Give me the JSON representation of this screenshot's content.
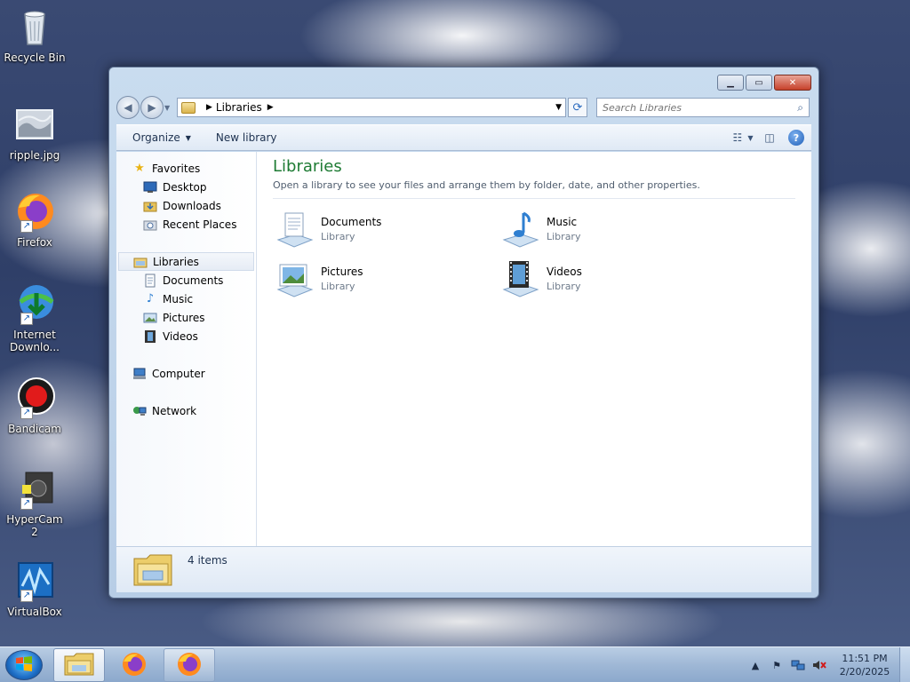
{
  "desktop": {
    "icons": [
      {
        "label": "Recycle Bin"
      },
      {
        "label": "ripple.jpg"
      },
      {
        "label": "Firefox"
      },
      {
        "label": "Internet Downlo..."
      },
      {
        "label": "Bandicam"
      },
      {
        "label": "HyperCam 2"
      },
      {
        "label": "VirtualBox"
      }
    ]
  },
  "window": {
    "address": {
      "crumb": "Libraries"
    },
    "search": {
      "placeholder": "Search Libraries"
    },
    "toolbar": {
      "organize_label": "Organize",
      "new_library_label": "New library"
    },
    "nav_pane": {
      "favorites": "Favorites",
      "favorites_items": [
        "Desktop",
        "Downloads",
        "Recent Places"
      ],
      "libraries": "Libraries",
      "libraries_items": [
        "Documents",
        "Music",
        "Pictures",
        "Videos"
      ],
      "computer": "Computer",
      "network": "Network"
    },
    "content": {
      "title": "Libraries",
      "description": "Open a library to see your files and arrange them by folder, date, and other properties.",
      "items": [
        {
          "name": "Documents",
          "type": "Library"
        },
        {
          "name": "Music",
          "type": "Library"
        },
        {
          "name": "Pictures",
          "type": "Library"
        },
        {
          "name": "Videos",
          "type": "Library"
        }
      ]
    },
    "details": {
      "count": "4 items"
    }
  },
  "taskbar": {
    "clock_time": "11:51 PM",
    "clock_date": "2/20/2025"
  },
  "colors": {
    "accent_green": "#1e7b34",
    "window_frame": "#c9dcef",
    "close_red": "#c6402a"
  },
  "icons": {
    "favorites": "star-icon",
    "desktop": "desktop-icon",
    "downloads": "downloads-folder-icon",
    "recent": "recent-places-icon",
    "libraries": "libraries-icon",
    "computer": "computer-icon",
    "network": "network-icon"
  }
}
